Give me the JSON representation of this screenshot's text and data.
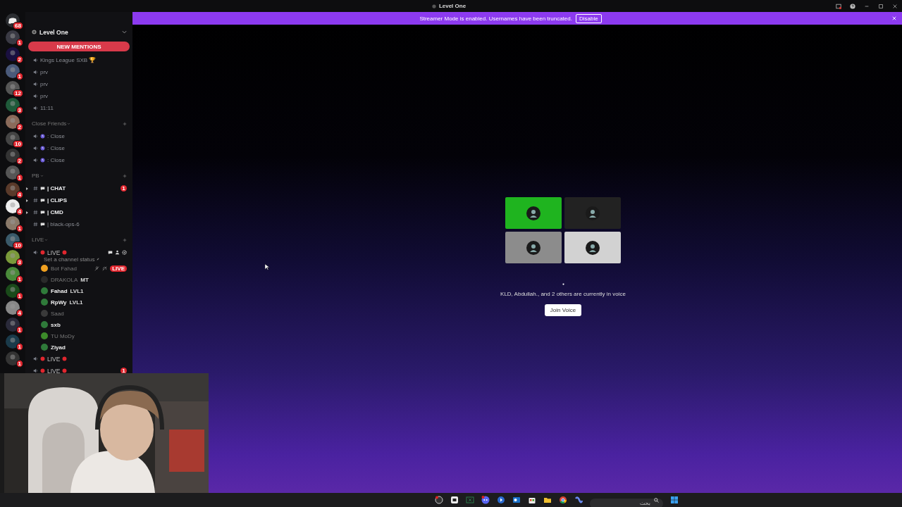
{
  "window": {
    "title": "Level One"
  },
  "banner": {
    "text": "Streamer Mode is enabled. Usernames have been truncated.",
    "button": "Disable"
  },
  "servers": [
    {
      "badge": "68",
      "kind": "home"
    },
    {
      "badge": "1"
    },
    {
      "badge": "2"
    },
    {
      "badge": "1"
    },
    {
      "badge": "12"
    },
    {
      "badge": "3"
    },
    {
      "badge": "2"
    },
    {
      "badge": "10"
    },
    {
      "badge": "2"
    },
    {
      "badge": "1"
    },
    {
      "badge": "4"
    },
    {
      "badge": "4"
    },
    {
      "badge": "1"
    },
    {
      "badge": "10"
    },
    {
      "badge": "3"
    },
    {
      "badge": "1"
    },
    {
      "badge": "1"
    },
    {
      "badge": "4"
    },
    {
      "badge": "1"
    },
    {
      "badge": "1"
    },
    {
      "badge": "1"
    }
  ],
  "server": {
    "name": "Level One"
  },
  "new_mentions": "NEW MENTIONS",
  "channels": [
    {
      "kind": "voice",
      "name": "Kings League SXB 🏆"
    },
    {
      "kind": "voice",
      "name": "prv"
    },
    {
      "kind": "voice",
      "name": "prv"
    },
    {
      "kind": "voice",
      "name": "prv"
    },
    {
      "kind": "voice",
      "name": "11:11"
    }
  ],
  "categories": [
    {
      "name": "Close Friends",
      "channels": [
        {
          "kind": "voice",
          "name": ": Close",
          "clock": true
        },
        {
          "kind": "voice",
          "name": ": Close",
          "clock": true
        },
        {
          "kind": "voice",
          "name": ": Close",
          "clock": true
        }
      ]
    },
    {
      "name": "PB",
      "channels": [
        {
          "kind": "text",
          "name": "| CHAT",
          "unread": true,
          "threads": true,
          "badge": "1"
        },
        {
          "kind": "text",
          "name": "| CLIPS",
          "unread": true,
          "threads": true
        },
        {
          "kind": "text",
          "name": "| CMD",
          "unread": true,
          "threads": true
        },
        {
          "kind": "text",
          "name": "| black-ops-6",
          "unread": false,
          "threads": false
        }
      ]
    },
    {
      "name": "LIVE",
      "channels": [
        {
          "kind": "voice",
          "name": "LIVE",
          "live_marks": true,
          "status": "Set a channel status",
          "members": [
            {
              "name": "Bot Fahad",
              "dimmed": true,
              "color": "#f0a020",
              "live": "LIVE"
            },
            {
              "name": "DRAKOLA",
              "dimmed": true,
              "color": "#2a2a2a",
              "tag": "MT"
            },
            {
              "name": "Fahad",
              "dimmed": false,
              "color": "#2f7a3a",
              "tag": "LVL1"
            },
            {
              "name": "RpWy",
              "dimmed": false,
              "color": "#2f7a3a",
              "tag": "LVL1"
            },
            {
              "name": "Saad",
              "dimmed": true,
              "color": "#3a3a3a"
            },
            {
              "name": "sxb",
              "dimmed": false,
              "color": "#2f7a3a"
            },
            {
              "name": "TU MoDy",
              "dimmed": true,
              "color": "#3c8a2a"
            },
            {
              "name": "Ziyad",
              "dimmed": false,
              "color": "#2f7a3a"
            }
          ]
        },
        {
          "kind": "voice",
          "name": "LIVE",
          "live_marks": true
        },
        {
          "kind": "voice",
          "name": "LIVE",
          "live_marks": true,
          "badge": "1"
        }
      ]
    }
  ],
  "voice_preview": {
    "tiles": [
      {
        "color": "#1fb41f"
      },
      {
        "color": "#222222"
      },
      {
        "color": "#8c8c8c"
      },
      {
        "color": "#d2d2d2"
      }
    ],
    "text": "KLD, Abdullah., and 2 others are currently in voice",
    "button": "Join Voice"
  },
  "taskbar": {
    "search_placeholder": "بحث"
  }
}
